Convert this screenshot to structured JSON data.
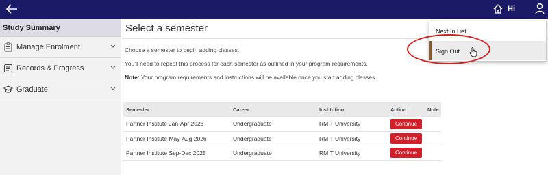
{
  "topbar": {
    "greeting": "Hi"
  },
  "sidebar": {
    "heading": "Study Summary",
    "items": [
      {
        "label": "Manage Enrolment",
        "icon": "clipboard-icon"
      },
      {
        "label": "Records & Progress",
        "icon": "records-icon"
      },
      {
        "label": "Graduate",
        "icon": "mortarboard-icon"
      }
    ]
  },
  "main": {
    "title": "Select a semester",
    "line1": "Choose a semester to begin adding classes.",
    "line2": "You'll need to repeat this process for each semester as outlined in your program requirements.",
    "note_label": "Note:",
    "note_text": " Your program requirements and instructions will be available once you start adding classes."
  },
  "table": {
    "headers": [
      "Semester",
      "Career",
      "Institution",
      "Action",
      "Note"
    ],
    "rows": [
      {
        "semester": "Partner Institute Jan-Apr 2026",
        "career": "Undergraduate",
        "institution": "RMIT University",
        "action": "Continue"
      },
      {
        "semester": "Partner Institute May-Aug 2026",
        "career": "Undergraduate",
        "institution": "RMIT University",
        "action": "Continue"
      },
      {
        "semester": "Partner Institute Sep-Dec 2025",
        "career": "Undergraduate",
        "institution": "RMIT University",
        "action": "Continue"
      }
    ]
  },
  "dropdown": {
    "items": [
      "Next In List",
      "Sign Out"
    ]
  },
  "colors": {
    "topbar": "#1a1a66",
    "continue_button": "#d21f2a",
    "highlight_oval": "#d42020"
  }
}
